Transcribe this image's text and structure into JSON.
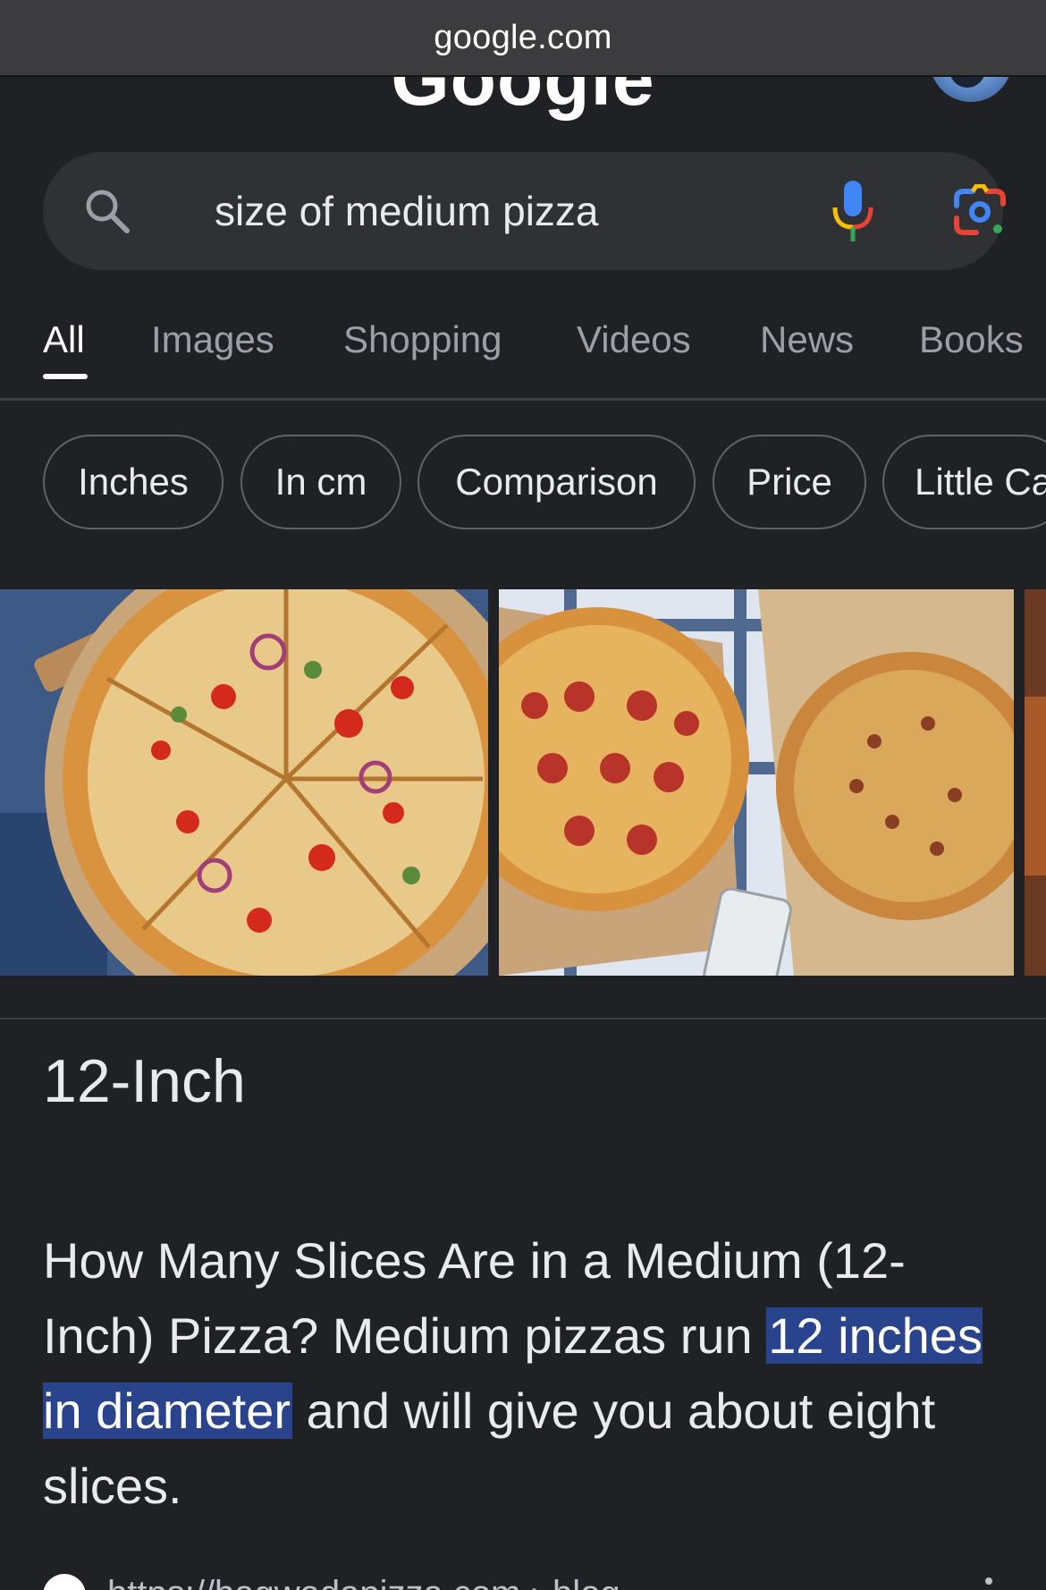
{
  "browser": {
    "url": "google.com"
  },
  "header": {
    "logo_text": "Google"
  },
  "search": {
    "query": "size of medium pizza"
  },
  "tabs": [
    {
      "label": "All"
    },
    {
      "label": "Images"
    },
    {
      "label": "Shopping"
    },
    {
      "label": "Videos"
    },
    {
      "label": "News"
    },
    {
      "label": "Books"
    }
  ],
  "chips": [
    {
      "label": "Inches"
    },
    {
      "label": "In cm"
    },
    {
      "label": "Comparison"
    },
    {
      "label": "Price"
    },
    {
      "label": "Little Ca"
    }
  ],
  "answer": {
    "title": "12-Inch",
    "snippet_before": "How Many Slices Are in a Medium (12-Inch) Pizza? Medium pizzas run ",
    "snippet_highlight": "12 inches in diameter",
    "snippet_after": " and will give you about eight slices."
  },
  "source": {
    "url": "https://bagwadapizza.com › blog"
  },
  "colors": {
    "background": "#202124",
    "search_bg": "#303134",
    "highlight": "#29438c",
    "muted_text": "#9aa0a6"
  }
}
